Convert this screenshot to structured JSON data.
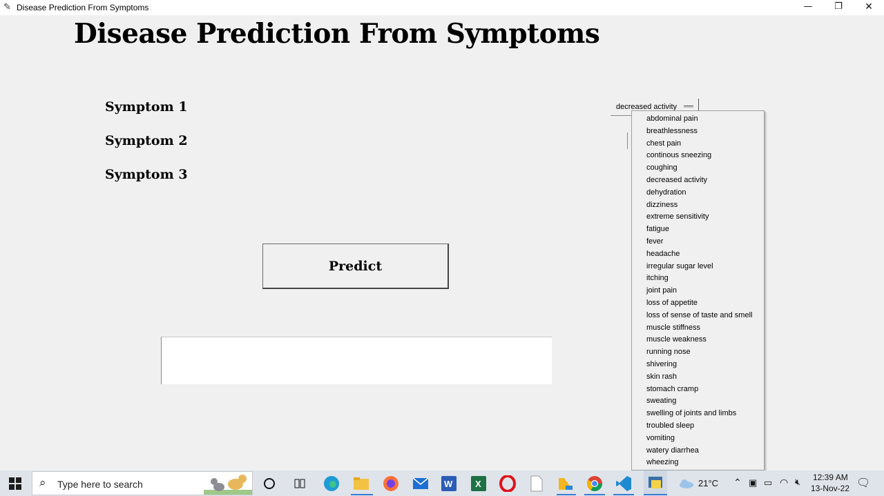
{
  "window": {
    "title": "Disease Prediction From Symptoms",
    "controls": {
      "minimize": "—",
      "maximize": "❐",
      "close": "✕"
    }
  },
  "heading": "Disease Prediction From Symptoms",
  "symptoms": {
    "label1": "Symptom 1",
    "label2": "Symptom 2",
    "label3": "Symptom 3",
    "selected1": "decreased activity"
  },
  "predict_button": "Predict",
  "result_text": "",
  "dropdown_options": [
    "abdominal pain",
    "breathlessness",
    "chest pain",
    "continous sneezing",
    "coughing",
    "decreased activity",
    "dehydration",
    "dizziness",
    "extreme sensitivity",
    "fatigue",
    "fever",
    "headache",
    "irregular sugar level",
    "itching",
    "joint pain",
    "loss of appetite",
    "loss of sense of taste and smell",
    "muscle stiffness",
    "muscle weakness",
    "running nose",
    "shivering",
    "skin rash",
    "stomach cramp",
    "sweating",
    "swelling of joints and limbs",
    "troubled sleep",
    "vomiting",
    "watery diarrhea",
    "wheezing"
  ],
  "taskbar": {
    "search_placeholder": "Type here to search",
    "weather": "21°C",
    "time": "12:39 AM",
    "date": "13-Nov-22",
    "apps": [
      "cortana-icon",
      "task-view-icon",
      "edge-icon",
      "file-explorer-icon",
      "firefox-icon",
      "mail-icon",
      "word-icon",
      "excel-icon",
      "opera-icon",
      "notepad-icon",
      "files-icon",
      "chrome-icon",
      "vscode-icon",
      "python-icon"
    ]
  }
}
